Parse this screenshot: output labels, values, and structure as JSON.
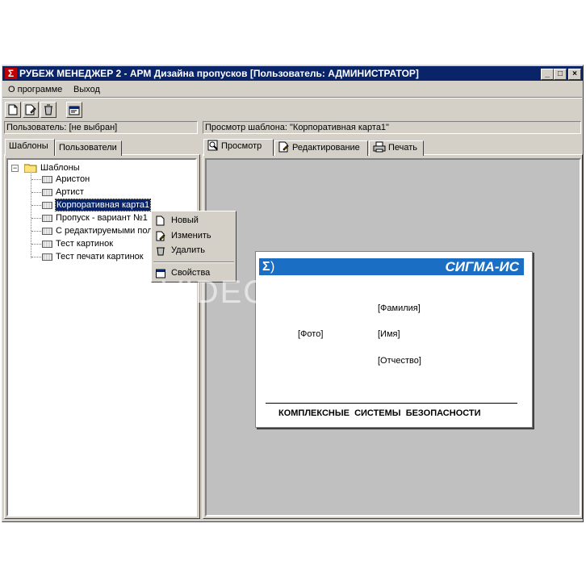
{
  "window": {
    "title": "РУБЕЖ МЕНЕДЖЕР 2 - АРМ Дизайна пропусков [Пользователь: АДМИНИСТРАТОР]",
    "minimize": "_",
    "maximize": "□",
    "close": "×"
  },
  "menu": [
    "О программе",
    "Выход"
  ],
  "status": {
    "user": "Пользователь: [не выбран]",
    "template": "Просмотр шаблона: \"Корпоративная карта1\""
  },
  "left_tabs": [
    "Шаблоны",
    "Пользователи"
  ],
  "tree": {
    "root": "Шаблоны",
    "items": [
      "Аристон",
      "Артист",
      "Корпоративная карта1",
      "Пропуск - вариант №1",
      "С редактируемыми пол",
      "Тест картинок",
      "Тест печати картинок"
    ],
    "selected_index": 2
  },
  "right_tabs": [
    "Просмотр",
    "Редактирование",
    "Печать"
  ],
  "context_menu": [
    "Новый",
    "Изменить",
    "Удалить",
    "Свойства"
  ],
  "card": {
    "logo_symbol": "Σ",
    "brand": "СИГМА-ИС",
    "photo": "[Фото]",
    "surname": "[Фамилия]",
    "name": "[Имя]",
    "patronymic": "[Отчество]",
    "footer": "КОМПЛЕКСНЫЕ  СИСТЕМЫ  БЕЗОПАСНОСТИ",
    "brand_color": "#1a6fc4"
  },
  "watermark": "VIDEOGLAZ.RU",
  "colors": {
    "titlebar": "#0a246a",
    "selection": "#0a246a",
    "face": "#d4d0c8"
  }
}
